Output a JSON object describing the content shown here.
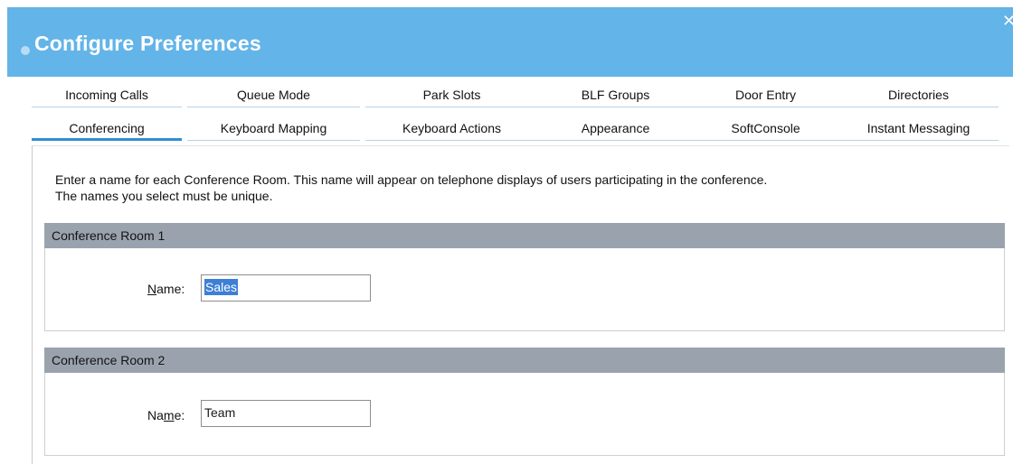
{
  "window": {
    "title": "Configure Preferences",
    "close_glyph": "✕"
  },
  "tabs_row1": [
    {
      "label": "Incoming Calls"
    },
    {
      "label": "Queue Mode"
    },
    {
      "label": "Park Slots"
    },
    {
      "label": "BLF Groups"
    },
    {
      "label": "Door Entry"
    },
    {
      "label": "Directories"
    }
  ],
  "tabs_row2": [
    {
      "label": "Conferencing",
      "active": true
    },
    {
      "label": "Keyboard Mapping"
    },
    {
      "label": "Keyboard Actions"
    },
    {
      "label": "Appearance"
    },
    {
      "label": "SoftConsole"
    },
    {
      "label": "Instant Messaging"
    }
  ],
  "description": {
    "line1": "Enter a name for each Conference Room. This name will appear on telephone displays of users participating in the conference.",
    "line2": "The names you select must be unique."
  },
  "rooms": [
    {
      "header": "Conference Room 1",
      "name_label_prefix": "",
      "name_label_underlined": "N",
      "name_label_suffix": "ame:",
      "value": "Sales",
      "value_selected": true
    },
    {
      "header": "Conference Room 2",
      "name_label_prefix": "Na",
      "name_label_underlined": "m",
      "name_label_suffix": "e:",
      "value": "Team",
      "value_selected": false
    }
  ]
}
